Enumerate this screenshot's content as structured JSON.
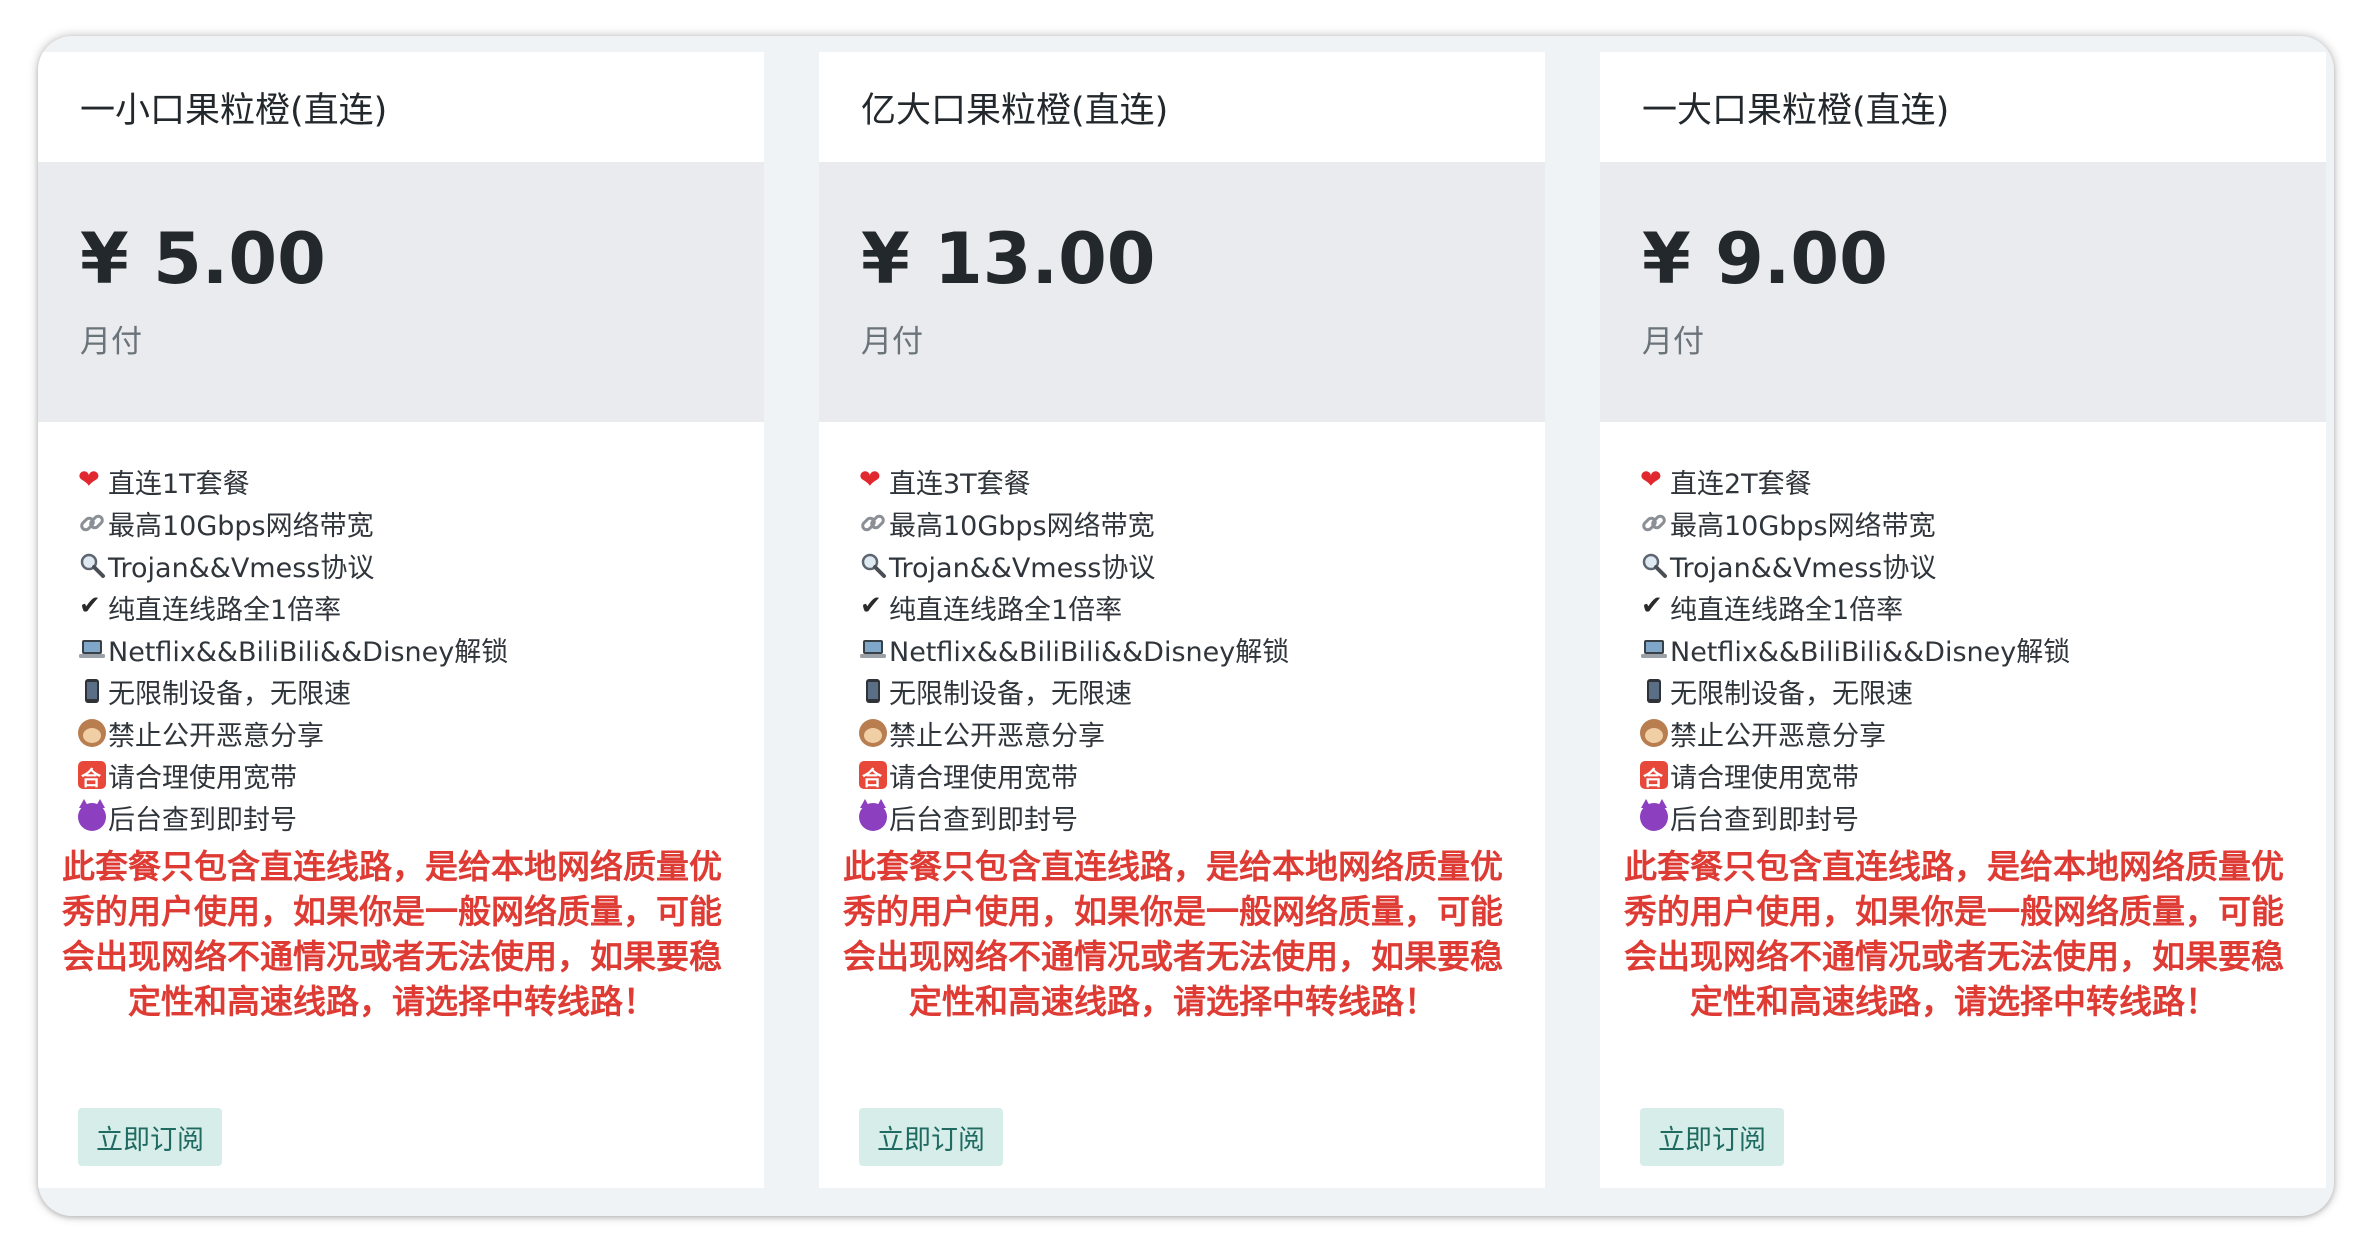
{
  "plans": [
    {
      "title": "一小口果粒橙(直连)",
      "price": "¥ 5.00",
      "period": "月付",
      "features": [
        {
          "icon": "heart-icon",
          "text": "直连1T套餐"
        },
        {
          "icon": "link-icon",
          "text": "最高10Gbps网络带宽"
        },
        {
          "icon": "search-icon",
          "text": "Trojan&&Vmess协议"
        },
        {
          "icon": "check-icon",
          "text": "纯直连线路全1倍率"
        },
        {
          "icon": "laptop-icon",
          "text": "Netflix&&BiliBili&&Disney解锁"
        },
        {
          "icon": "phone-icon",
          "text": "无限制设备，无限速"
        },
        {
          "icon": "monkey-icon",
          "text": "禁止公开恶意分享"
        },
        {
          "icon": "seal-icon",
          "text": "请合理使用宽带"
        },
        {
          "icon": "devil-icon",
          "text": "后台查到即封号"
        }
      ],
      "notice": "此套餐只包含直连线路，是给本地网络质量优秀的用户使用，如果你是一般网络质量，可能会出现网络不通情况或者无法使用，如果要稳定性和高速线路，请选择中转线路！",
      "button": "立即订阅"
    },
    {
      "title": "亿大口果粒橙(直连)",
      "price": "¥ 13.00",
      "period": "月付",
      "features": [
        {
          "icon": "heart-icon",
          "text": "直连3T套餐"
        },
        {
          "icon": "link-icon",
          "text": "最高10Gbps网络带宽"
        },
        {
          "icon": "search-icon",
          "text": "Trojan&&Vmess协议"
        },
        {
          "icon": "check-icon",
          "text": "纯直连线路全1倍率"
        },
        {
          "icon": "laptop-icon",
          "text": "Netflix&&BiliBili&&Disney解锁"
        },
        {
          "icon": "phone-icon",
          "text": "无限制设备，无限速"
        },
        {
          "icon": "monkey-icon",
          "text": "禁止公开恶意分享"
        },
        {
          "icon": "seal-icon",
          "text": "请合理使用宽带"
        },
        {
          "icon": "devil-icon",
          "text": "后台查到即封号"
        }
      ],
      "notice": "此套餐只包含直连线路，是给本地网络质量优秀的用户使用，如果你是一般网络质量，可能会出现网络不通情况或者无法使用，如果要稳定性和高速线路，请选择中转线路！",
      "button": "立即订阅"
    },
    {
      "title": "一大口果粒橙(直连)",
      "price": "¥ 9.00",
      "period": "月付",
      "features": [
        {
          "icon": "heart-icon",
          "text": "直连2T套餐"
        },
        {
          "icon": "link-icon",
          "text": "最高10Gbps网络带宽"
        },
        {
          "icon": "search-icon",
          "text": "Trojan&&Vmess协议"
        },
        {
          "icon": "check-icon",
          "text": "纯直连线路全1倍率"
        },
        {
          "icon": "laptop-icon",
          "text": "Netflix&&BiliBili&&Disney解锁"
        },
        {
          "icon": "phone-icon",
          "text": "无限制设备，无限速"
        },
        {
          "icon": "monkey-icon",
          "text": "禁止公开恶意分享"
        },
        {
          "icon": "seal-icon",
          "text": "请合理使用宽带"
        },
        {
          "icon": "devil-icon",
          "text": "后台查到即封号"
        }
      ],
      "notice": "此套餐只包含直连线路，是给本地网络质量优秀的用户使用，如果你是一般网络质量，可能会出现网络不通情况或者无法使用，如果要稳定性和高速线路，请选择中转线路！",
      "button": "立即订阅"
    }
  ],
  "colors": {
    "notice": "#de3b34",
    "button_bg": "#d7ede9",
    "button_text": "#1f6b62",
    "price_bg": "#e9ebee",
    "page_bg": "#f0f3f5"
  }
}
